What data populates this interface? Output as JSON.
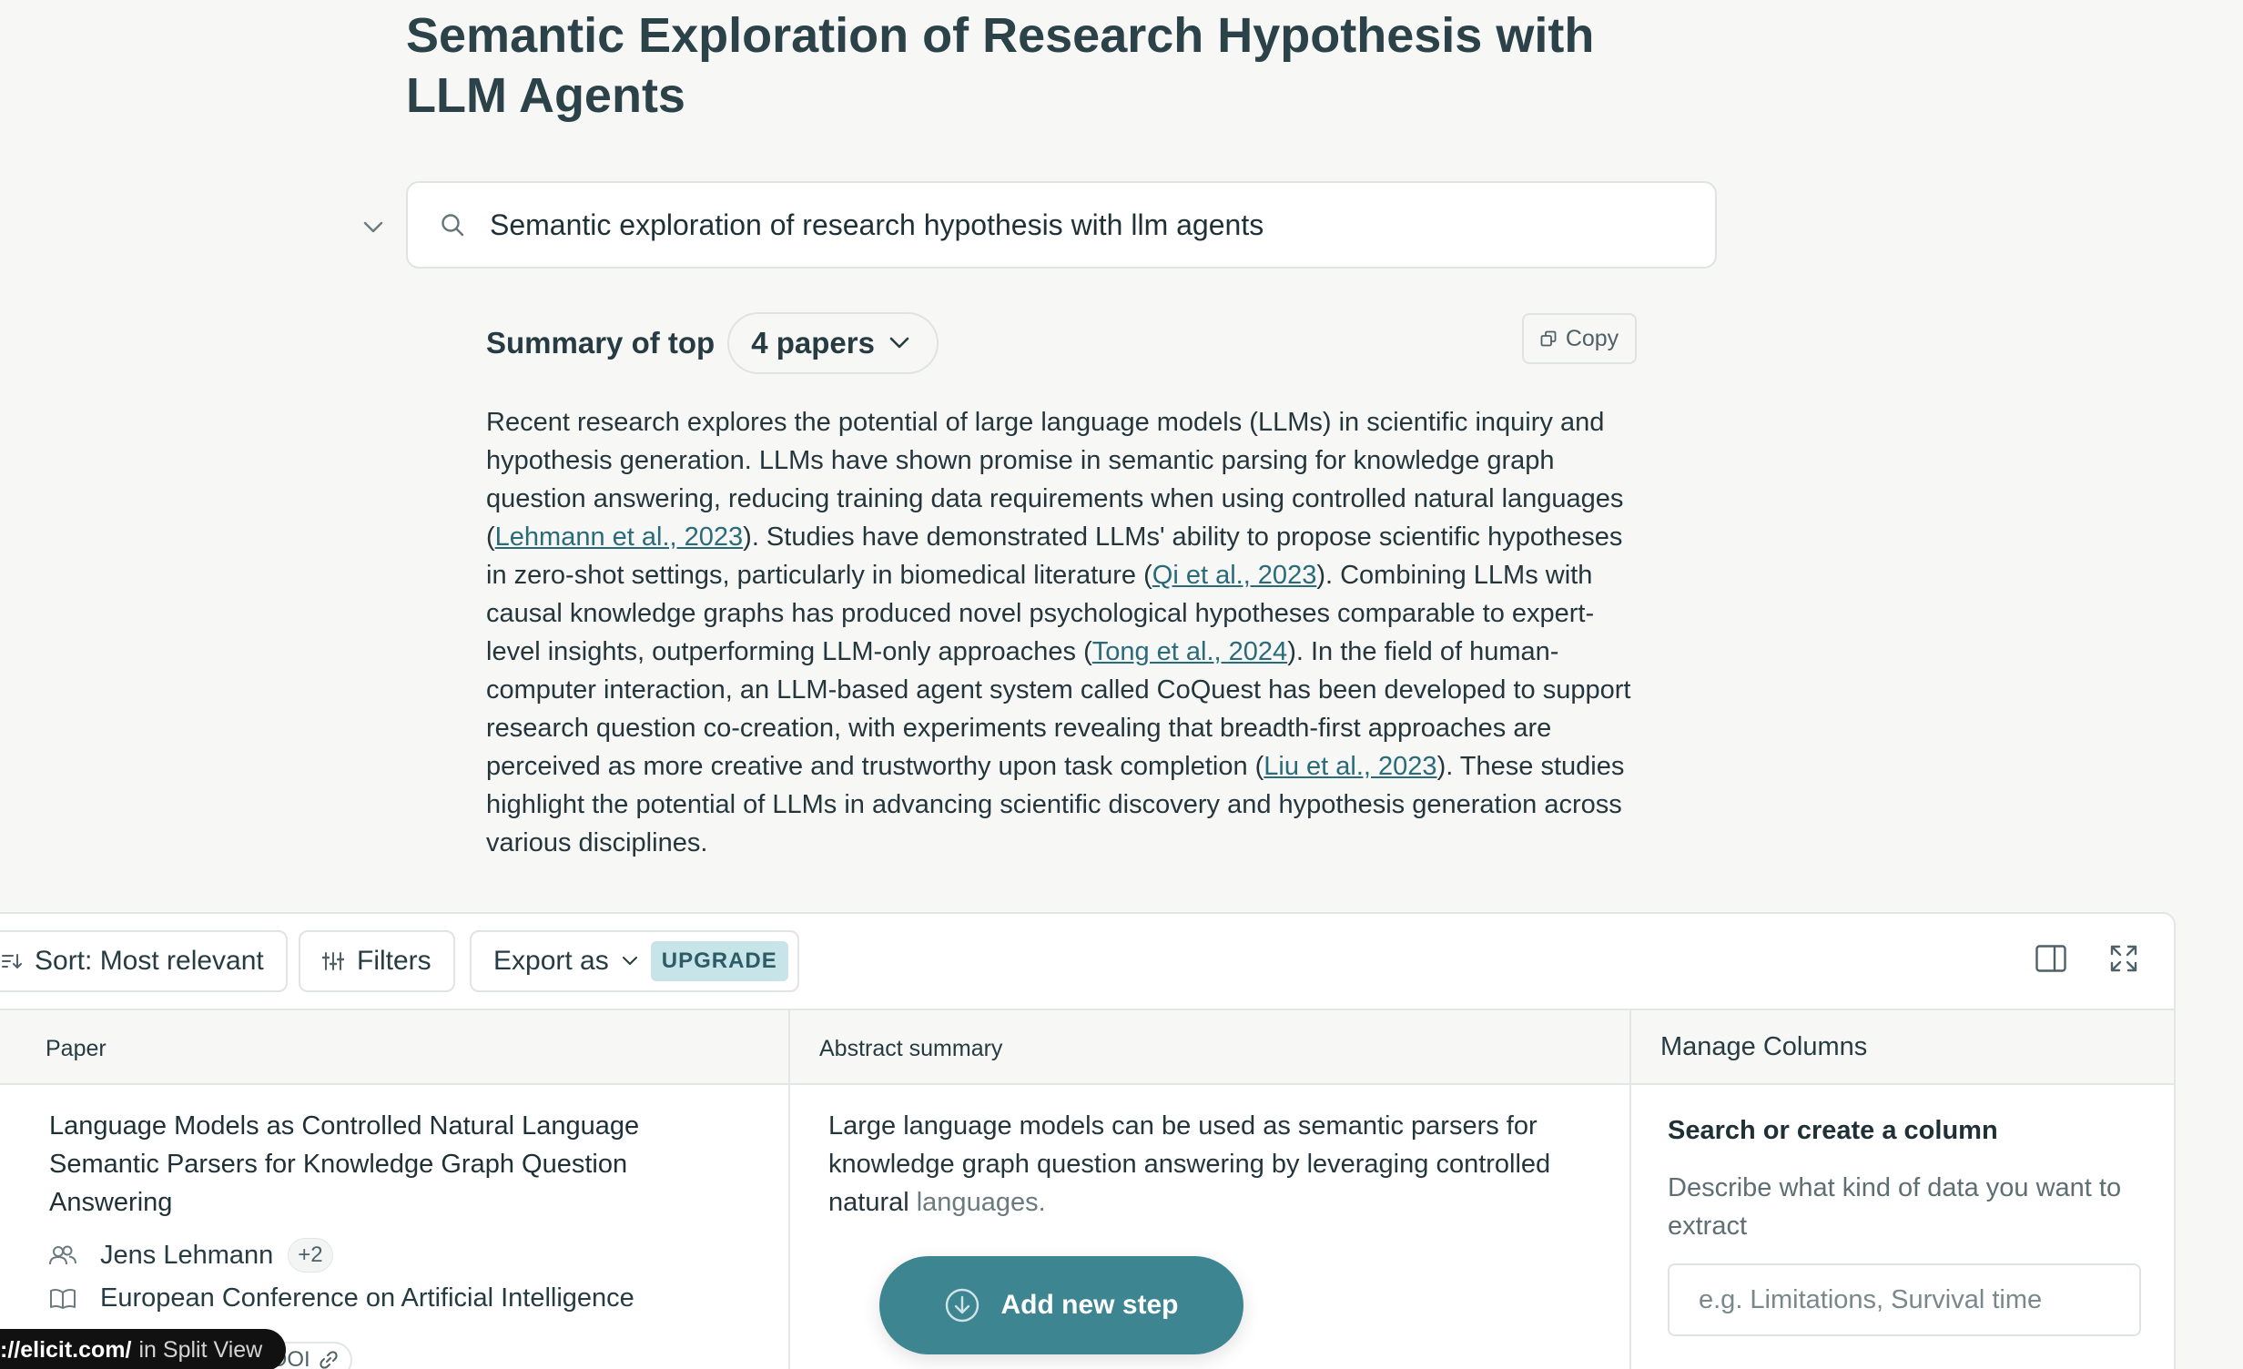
{
  "page": {
    "title": "Semantic Exploration of Research Hypothesis with LLM Agents"
  },
  "search": {
    "value": "Semantic exploration of research hypothesis with llm agents"
  },
  "summary": {
    "label": "Summary of top",
    "papers_dropdown": "4 papers",
    "copy_label": "Copy",
    "text_parts": [
      "Recent research explores the potential of large language models (LLMs) in scientific inquiry and hypothesis generation. LLMs have shown promise in semantic parsing for knowledge graph question answering, reducing training data requirements when using controlled natural languages (",
      "Lehmann et al., 2023",
      "). Studies have demonstrated LLMs' ability to propose scientific hypotheses in zero-shot settings, particularly in biomedical literature (",
      "Qi et al., 2023",
      "). Combining LLMs with causal knowledge graphs has produced novel psychological hypotheses comparable to expert-level insights, outperforming LLM-only approaches (",
      "Tong et al., 2024",
      "). In the field of human-computer interaction, an LLM-based agent system called CoQuest has been developed to support research question co-creation, with experiments revealing that breadth-first approaches are perceived as more creative and trustworthy upon task completion (",
      "Liu et al., 2023",
      "). These studies highlight the potential of LLMs in advancing scientific discovery and hypothesis generation across various disciplines."
    ]
  },
  "toolbar": {
    "sort_label": "Sort: Most relevant",
    "filters_label": "Filters",
    "export_label": "Export as",
    "upgrade_badge": "UPGRADE"
  },
  "table": {
    "columns": {
      "paper": "Paper",
      "abstract": "Abstract summary",
      "manage": "Manage Columns"
    },
    "rows": [
      {
        "title": "Language Models as Controlled Natural Language Semantic Parsers for Knowledge Graph Question Answering",
        "author": "Jens Lehmann",
        "more_authors": "+2",
        "venue": "European Conference on Artificial Intelligence",
        "doi": "DOI",
        "abstract_main": "Large language models can be used as semantic parsers for knowledge graph question answering by leveraging controlled natural ",
        "abstract_faded": "languages."
      }
    ]
  },
  "manage_columns": {
    "title": "Search or create a column",
    "description": "Describe what kind of data you want to extract",
    "placeholder": "e.g. Limitations, Survival time"
  },
  "add_step": {
    "label": "Add new step"
  },
  "tooltip": {
    "url": "://elicit.com/",
    "rest": "in Split View"
  },
  "colors": {
    "accent": "#3d8591",
    "badge_bg": "#c7e4e8",
    "link": "#2a6b7a",
    "title": "#2b4249"
  }
}
